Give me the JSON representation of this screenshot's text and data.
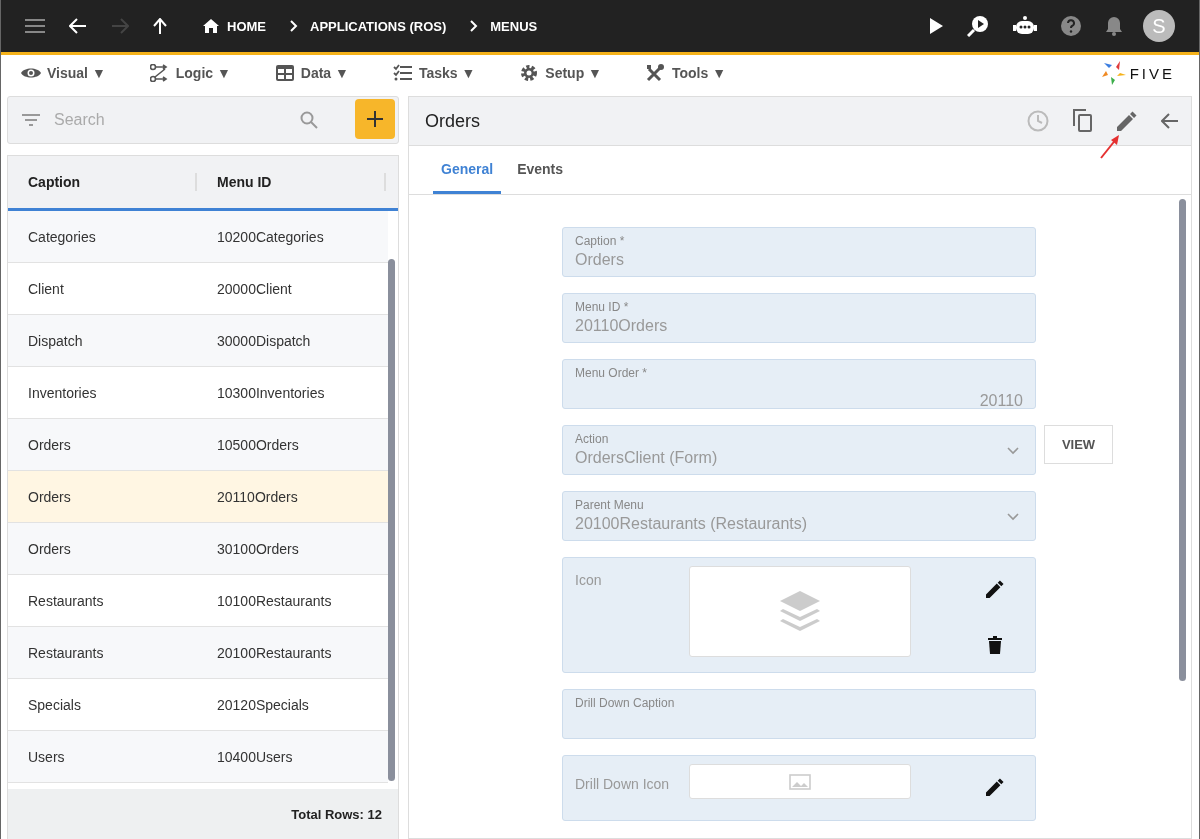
{
  "top_bar": {
    "breadcrumbs": [
      "HOME",
      "APPLICATIONS (ROS)",
      "MENUS"
    ],
    "avatar": "S"
  },
  "menu_bar": {
    "items": [
      "Visual ▼",
      "Logic ▼",
      "Data ▼",
      "Tasks ▼",
      "Setup ▼",
      "Tools ▼"
    ],
    "logo": "FIVE"
  },
  "list": {
    "search": {
      "placeholder": "Search"
    },
    "columns": [
      "Caption",
      "Menu ID"
    ],
    "rows": [
      {
        "caption": "Categories",
        "menu_id": "10200Categories",
        "selected": false
      },
      {
        "caption": "Client",
        "menu_id": "20000Client",
        "selected": false
      },
      {
        "caption": "Dispatch",
        "menu_id": "30000Dispatch",
        "selected": false
      },
      {
        "caption": "Inventories",
        "menu_id": "10300Inventories",
        "selected": false
      },
      {
        "caption": "Orders",
        "menu_id": "10500Orders",
        "selected": false
      },
      {
        "caption": "Orders",
        "menu_id": "20110Orders",
        "selected": true
      },
      {
        "caption": "Orders",
        "menu_id": "30100Orders",
        "selected": false
      },
      {
        "caption": "Restaurants",
        "menu_id": "10100Restaurants",
        "selected": false
      },
      {
        "caption": "Restaurants",
        "menu_id": "20100Restaurants",
        "selected": false
      },
      {
        "caption": "Specials",
        "menu_id": "20120Specials",
        "selected": false
      },
      {
        "caption": "Users",
        "menu_id": "10400Users",
        "selected": false
      }
    ],
    "total": "Total Rows: 12"
  },
  "detail": {
    "title": "Orders",
    "tabs": [
      {
        "label": "General",
        "selected": true
      },
      {
        "label": "Events",
        "selected": false
      }
    ],
    "fields": [
      {
        "kind": "text",
        "label": "Caption *",
        "value": "Orders"
      },
      {
        "kind": "text",
        "label": "Menu ID *",
        "value": "20110Orders"
      },
      {
        "kind": "number",
        "label": "Menu Order *",
        "value": "20110"
      },
      {
        "kind": "select",
        "label": "Action",
        "value": "OrdersClient (Form)",
        "button": "VIEW"
      },
      {
        "kind": "select",
        "label": "Parent Menu",
        "value": "20100Restaurants (Restaurants)"
      },
      {
        "kind": "image",
        "label": "Icon",
        "has_image": true
      },
      {
        "kind": "text",
        "label": "Drill Down Caption"
      },
      {
        "kind": "image",
        "label": "Drill Down Icon",
        "has_image": false
      }
    ]
  }
}
